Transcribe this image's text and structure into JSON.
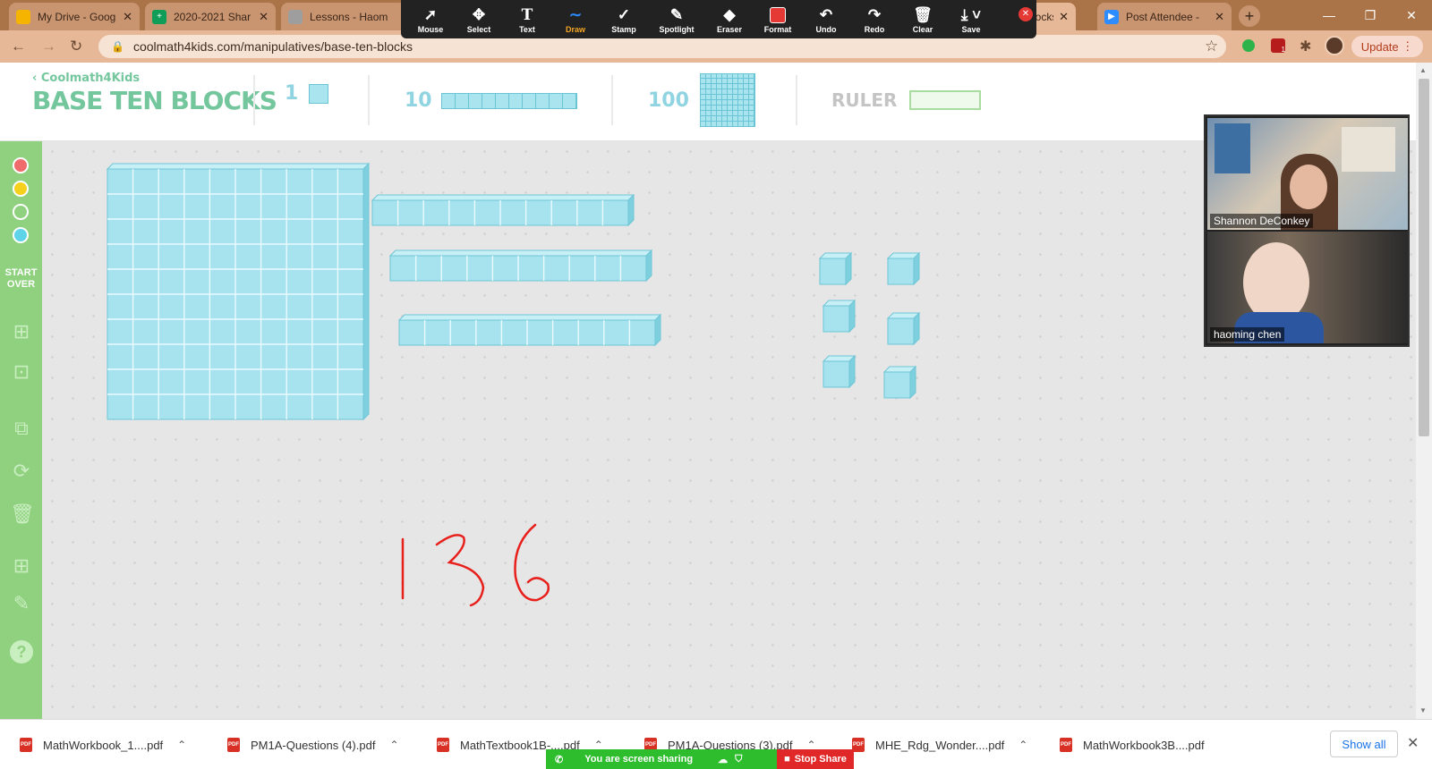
{
  "browser": {
    "tabs": [
      {
        "title": "My Drive - Goog",
        "favicon": "google-drive-icon",
        "color": "#f4b400"
      },
      {
        "title": "2020-2021 Shar",
        "favicon": "google-sheets-icon",
        "color": "#0f9d58"
      },
      {
        "title": "Lessons - Haom",
        "favicon": "doc-icon",
        "color": "#9e9e9e"
      },
      {
        "title": "Blocks",
        "favicon": "coolmath-icon",
        "color": "#e53935"
      },
      {
        "title": "Post Attendee -",
        "favicon": "zoom-icon",
        "color": "#2d8cff"
      }
    ],
    "url": "coolmath4kids.com/manipulatives/base-ten-blocks",
    "update_label": "Update",
    "extension_badge": "1"
  },
  "zoom_toolbar": {
    "tools": [
      {
        "label": "Mouse",
        "icon": "cursor-icon"
      },
      {
        "label": "Select",
        "icon": "move-icon"
      },
      {
        "label": "Text",
        "icon": "text-icon"
      },
      {
        "label": "Draw",
        "icon": "draw-icon",
        "active": true
      },
      {
        "label": "Stamp",
        "icon": "stamp-icon"
      },
      {
        "label": "Spotlight",
        "icon": "spotlight-icon"
      },
      {
        "label": "Eraser",
        "icon": "eraser-icon"
      },
      {
        "label": "Format",
        "icon": "format-icon",
        "color": "#e53935"
      },
      {
        "label": "Undo",
        "icon": "undo-icon"
      },
      {
        "label": "Redo",
        "icon": "redo-icon"
      },
      {
        "label": "Clear",
        "icon": "trash-icon"
      },
      {
        "label": "Save",
        "icon": "save-icon"
      }
    ]
  },
  "app": {
    "back_brand": "Coolmath4Kids",
    "title": "BASE TEN BLOCKS",
    "palette": {
      "one_label": "1",
      "ten_label": "10",
      "hundred_label": "100",
      "ruler_label": "RULER"
    },
    "sidebar": {
      "colors": [
        "#f06b6b",
        "#f5d11e",
        "#8fd17f",
        "#5fd3e8"
      ],
      "start_over_line1": "START",
      "start_over_line2": "OVER"
    },
    "workspace": {
      "hundreds": 1,
      "tens": 3,
      "ones": 6,
      "handwritten_text": "136",
      "ink_color": "#e8201c"
    }
  },
  "participants": [
    {
      "name": "Shannon DeConkey"
    },
    {
      "name": "haoming chen"
    }
  ],
  "downloads": {
    "files": [
      "MathWorkbook_1....pdf",
      "PM1A-Questions (4).pdf",
      "MathTextbook1B-....pdf",
      "PM1A-Questions (3).pdf",
      "MHE_Rdg_Wonder....pdf",
      "MathWorkbook3B....pdf"
    ],
    "show_all": "Show all"
  },
  "share_bar": {
    "status": "You are screen sharing",
    "stop_label": "Stop Share"
  }
}
